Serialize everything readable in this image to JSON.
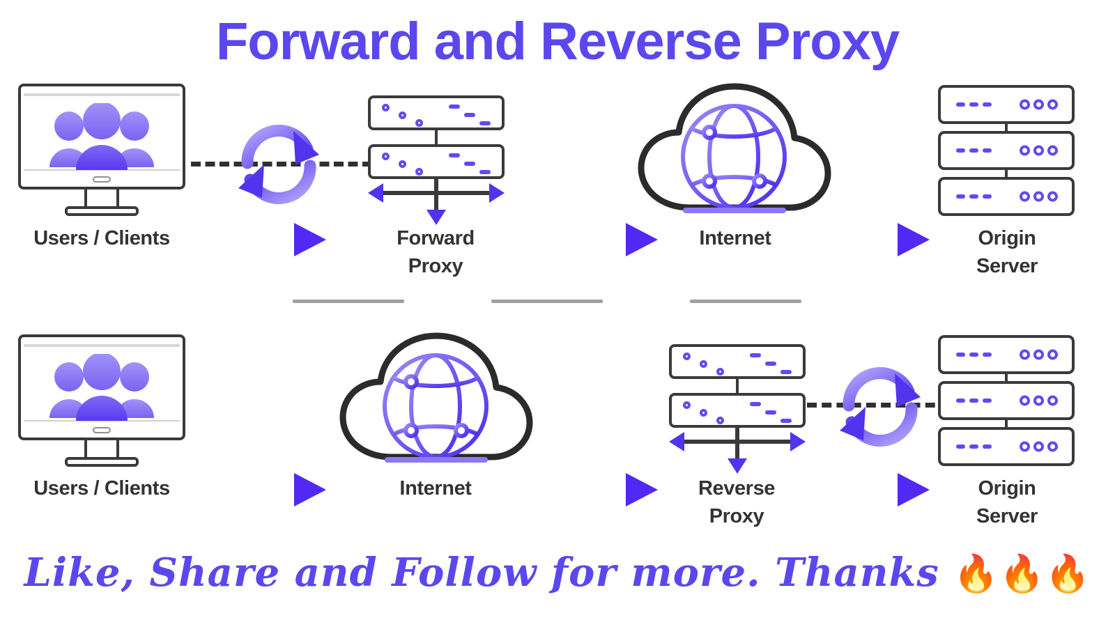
{
  "title": "Forward and Reverse Proxy",
  "colors": {
    "accent_purple": "#5B47EE",
    "icon_purple": "#6348F2",
    "outline_dark": "#3a3a3a",
    "divider_gray": "#a0a0a0",
    "background": "#ffffff",
    "label_text": "#333333"
  },
  "rows": [
    {
      "name": "forward-proxy-flow",
      "nodes": [
        {
          "id": "users-clients",
          "label": "Users / Clients",
          "icon": "monitor-users-icon"
        },
        {
          "id": "forward-proxy",
          "label": "Forward\nProxy",
          "icon": "server-rack-proxy-icon"
        },
        {
          "id": "internet",
          "label": "Internet",
          "icon": "cloud-globe-icon"
        },
        {
          "id": "origin-server",
          "label": "Origin\nServer",
          "icon": "server-rack-icon"
        }
      ],
      "connectors": [
        {
          "type": "sync-arrows-icon",
          "between": [
            "users-clients",
            "forward-proxy"
          ]
        },
        {
          "type": "dashed-line",
          "between": [
            "users-clients",
            "forward-proxy"
          ]
        },
        {
          "type": "flow-arrow-icon",
          "between": [
            "users-clients",
            "forward-proxy"
          ]
        },
        {
          "type": "flow-arrow-icon",
          "between": [
            "forward-proxy",
            "internet"
          ]
        },
        {
          "type": "flow-arrow-icon",
          "between": [
            "internet",
            "origin-server"
          ]
        }
      ]
    },
    {
      "name": "reverse-proxy-flow",
      "nodes": [
        {
          "id": "users-clients",
          "label": "Users / Clients",
          "icon": "monitor-users-icon"
        },
        {
          "id": "internet",
          "label": "Internet",
          "icon": "cloud-globe-icon"
        },
        {
          "id": "reverse-proxy",
          "label": "Reverse\nProxy",
          "icon": "server-rack-proxy-icon"
        },
        {
          "id": "origin-server",
          "label": "Origin\nServer",
          "icon": "server-rack-icon"
        }
      ],
      "connectors": [
        {
          "type": "flow-arrow-icon",
          "between": [
            "users-clients",
            "internet"
          ]
        },
        {
          "type": "flow-arrow-icon",
          "between": [
            "internet",
            "reverse-proxy"
          ]
        },
        {
          "type": "sync-arrows-icon",
          "between": [
            "reverse-proxy",
            "origin-server"
          ]
        },
        {
          "type": "dashed-line",
          "between": [
            "reverse-proxy",
            "origin-server"
          ]
        },
        {
          "type": "flow-arrow-icon",
          "between": [
            "reverse-proxy",
            "origin-server"
          ]
        }
      ]
    }
  ],
  "dividers": 3,
  "tagline": {
    "text": "Like,  Share and Follow for more.  Thanks ",
    "emoji": "🔥🔥🔥"
  }
}
